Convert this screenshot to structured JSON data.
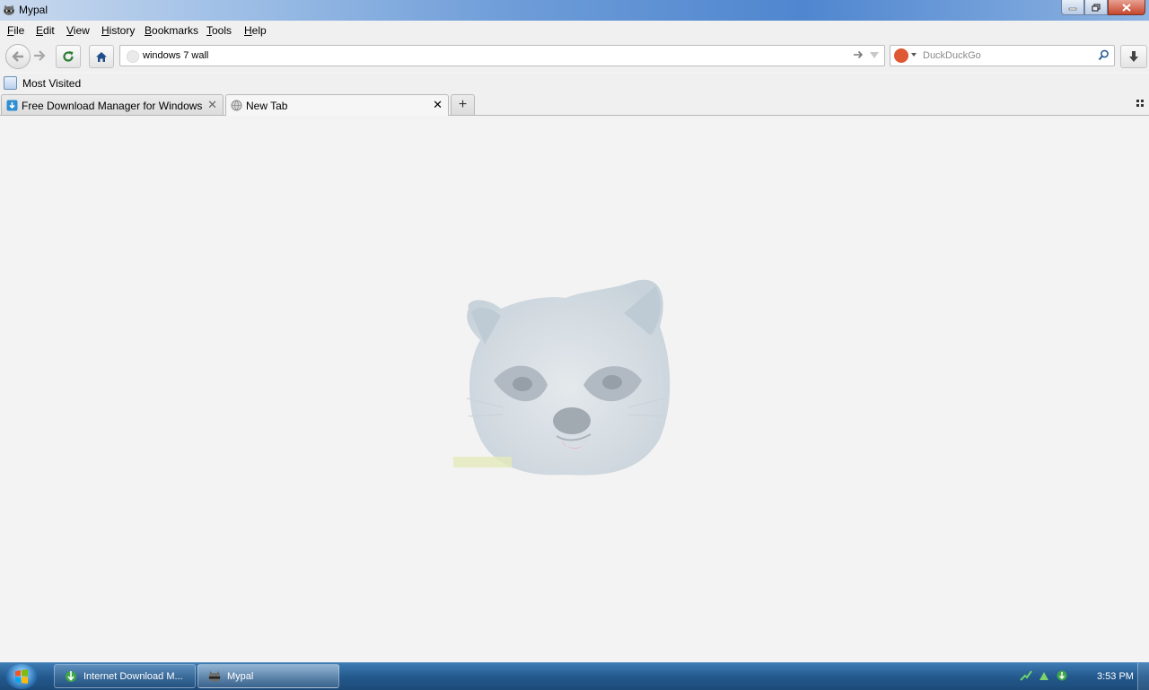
{
  "window": {
    "title": "Mypal"
  },
  "menubar": {
    "items": [
      {
        "label": "File",
        "accel": "F",
        "rest": "ile"
      },
      {
        "label": "Edit",
        "accel": "E",
        "rest": "dit"
      },
      {
        "label": "View",
        "accel": "V",
        "rest": "iew"
      },
      {
        "label": "History",
        "accel": "H",
        "rest": "istory"
      },
      {
        "label": "Bookmarks",
        "accel": "B",
        "rest": "ookmarks"
      },
      {
        "label": "Tools",
        "accel": "T",
        "rest": "ools"
      },
      {
        "label": "Help",
        "accel": "H",
        "rest": "elp"
      }
    ]
  },
  "navbar": {
    "url_value": "windows 7 wall",
    "search_placeholder": "DuckDuckGo"
  },
  "bookmarks": {
    "most_visited": "Most Visited"
  },
  "tabs": [
    {
      "title": "Free Download Manager for Windows | Do...",
      "selected": false
    },
    {
      "title": "New Tab",
      "selected": true
    }
  ],
  "content": {
    "logo": "raccoon-logo"
  },
  "taskbar": {
    "tasks": [
      {
        "label": "Internet Download M...",
        "active": false
      },
      {
        "label": "Mypal",
        "active": true
      }
    ],
    "clock": "3:53 PM"
  },
  "colors": {
    "accent": "#4f86cf",
    "taskbar": "#245a8e",
    "search_engine": "#de5833"
  }
}
